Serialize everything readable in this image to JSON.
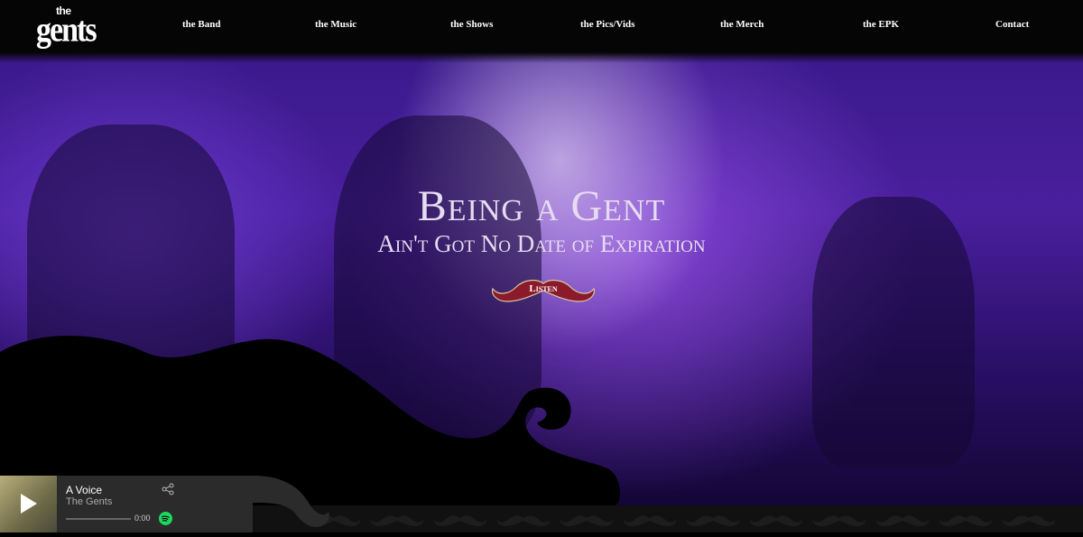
{
  "logo": {
    "line1": "the",
    "line2": "gents"
  },
  "nav": [
    {
      "label": "the Band"
    },
    {
      "label": "the Music"
    },
    {
      "label": "the Shows"
    },
    {
      "label": "the Pics/Vids"
    },
    {
      "label": "the Merch"
    },
    {
      "label": "the EPK"
    },
    {
      "label": "Contact"
    }
  ],
  "hero": {
    "title": "Being a Gent",
    "subtitle": "Ain't Got No Date of Expiration",
    "cta_label": "Listen"
  },
  "social": [
    {
      "icon": "twitter-icon"
    },
    {
      "icon": "spotify-icon"
    },
    {
      "icon": "facebook-icon"
    },
    {
      "icon": "youtube-icon"
    }
  ],
  "player": {
    "track": "A Voice",
    "artist": "The Gents",
    "time": "0:00",
    "progress": 0
  },
  "colors": {
    "accent": "#8b1a2b",
    "hero_purple": "#4a1f9e",
    "nav_bg": "#050505"
  }
}
